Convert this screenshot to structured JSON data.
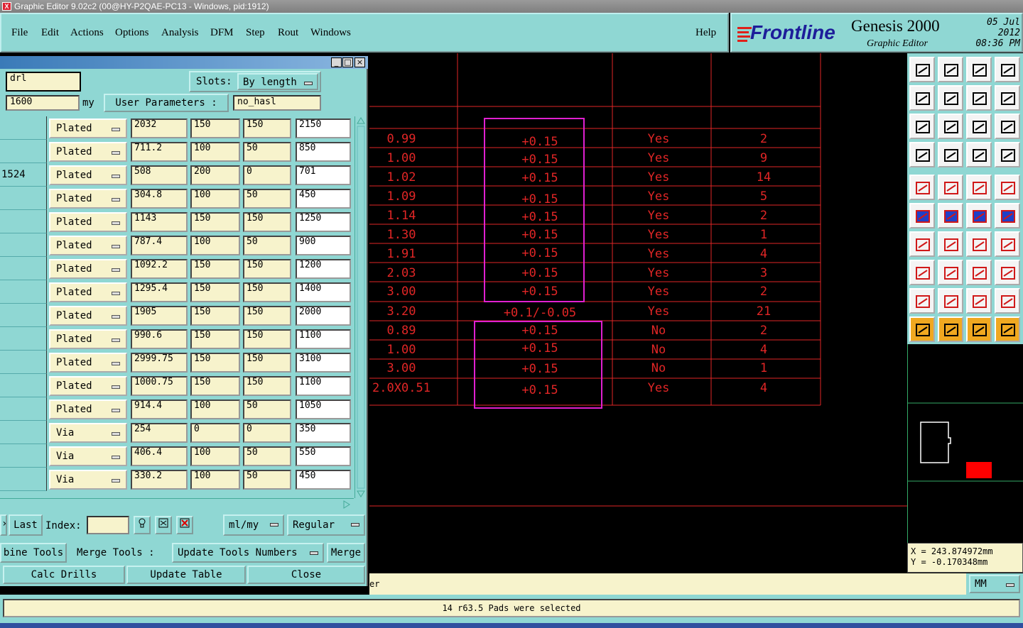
{
  "window": {
    "title": "Graphic Editor 9.02c2 (00@HY-P2QAE-PC13 - Windows, pid:1912)"
  },
  "menu": [
    "File",
    "Edit",
    "Actions",
    "Options",
    "Analysis",
    "DFM",
    "Step",
    "Rout",
    "Windows"
  ],
  "help": "Help",
  "brand": {
    "logo": "Frontline",
    "product": "Genesis 2000",
    "subtitle": "Graphic Editor",
    "date": "05 Jul 2012",
    "time": "08:36 PM"
  },
  "dialog": {
    "layer": "drl",
    "slots_label": "Slots:",
    "slots_value": "By length",
    "thickness": "1600",
    "thickness_unit": "my",
    "user_params_label": "User Parameters :",
    "user_params_value": "no_hasl",
    "rows": [
      {
        "c0": "",
        "type": "Plated",
        "v1": "2032",
        "v2": "150",
        "v3": "150",
        "v4": "2150"
      },
      {
        "c0": "",
        "type": "Plated",
        "v1": "711.2",
        "v2": "100",
        "v3": "50",
        "v4": "850"
      },
      {
        "c0": "1524",
        "type": "Plated",
        "v1": "508",
        "v2": "200",
        "v3": "0",
        "v4": "701"
      },
      {
        "c0": "",
        "type": "Plated",
        "v1": "304.8",
        "v2": "100",
        "v3": "50",
        "v4": "450"
      },
      {
        "c0": "",
        "type": "Plated",
        "v1": "1143",
        "v2": "150",
        "v3": "150",
        "v4": "1250"
      },
      {
        "c0": "",
        "type": "Plated",
        "v1": "787.4",
        "v2": "100",
        "v3": "50",
        "v4": "900"
      },
      {
        "c0": "",
        "type": "Plated",
        "v1": "1092.2",
        "v2": "150",
        "v3": "150",
        "v4": "1200"
      },
      {
        "c0": "",
        "type": "Plated",
        "v1": "1295.4",
        "v2": "150",
        "v3": "150",
        "v4": "1400"
      },
      {
        "c0": "",
        "type": "Plated",
        "v1": "1905",
        "v2": "150",
        "v3": "150",
        "v4": "2000"
      },
      {
        "c0": "",
        "type": "Plated",
        "v1": "990.6",
        "v2": "150",
        "v3": "150",
        "v4": "1100"
      },
      {
        "c0": "",
        "type": "Plated",
        "v1": "2999.75",
        "v2": "150",
        "v3": "150",
        "v4": "3100"
      },
      {
        "c0": "",
        "type": "Plated",
        "v1": "1000.75",
        "v2": "150",
        "v3": "150",
        "v4": "1100"
      },
      {
        "c0": "",
        "type": "Plated",
        "v1": "914.4",
        "v2": "100",
        "v3": "50",
        "v4": "1050"
      },
      {
        "c0": "",
        "type": "Via",
        "v1": "254",
        "v2": "0",
        "v3": "0",
        "v4": "350"
      },
      {
        "c0": "",
        "type": "Via",
        "v1": "406.4",
        "v2": "100",
        "v3": "50",
        "v4": "550"
      },
      {
        "c0": "",
        "type": "Via",
        "v1": "330.2",
        "v2": "100",
        "v3": "50",
        "v4": "450"
      }
    ],
    "last_label": "Last",
    "index_label": "Index:",
    "units_value": "ml/my",
    "mode_value": "Regular",
    "combine_tools": "bine Tools",
    "merge_tools": "Merge Tools :",
    "update_tools_numbers": "Update Tools Numbers",
    "merge": "Merge",
    "calc_drills": "Calc Drills",
    "update_table": "Update Table",
    "close": "Close"
  },
  "drawing": {
    "rows": [
      {
        "size": "0.99",
        "tol": "+0.15",
        "plated": "Yes",
        "count": "2"
      },
      {
        "size": "1.00",
        "tol": "+0.15",
        "plated": "Yes",
        "count": "9"
      },
      {
        "size": "1.02",
        "tol": "+0.15",
        "plated": "Yes",
        "count": "14"
      },
      {
        "size": "1.09",
        "tol": "+0.15",
        "plated": "Yes",
        "count": "5"
      },
      {
        "size": "1.14",
        "tol": "+0.15",
        "plated": "Yes",
        "count": "2"
      },
      {
        "size": "1.30",
        "tol": "+0.15",
        "plated": "Yes",
        "count": "1"
      },
      {
        "size": "1.91",
        "tol": "+0.15",
        "plated": "Yes",
        "count": "4"
      },
      {
        "size": "2.03",
        "tol": "+0.15",
        "plated": "Yes",
        "count": "3"
      },
      {
        "size": "3.00",
        "tol": "+0.15",
        "plated": "Yes",
        "count": "2"
      },
      {
        "size": "3.20",
        "tol": "+0.1/-0.05",
        "plated": "Yes",
        "count": "21"
      },
      {
        "size": "0.89",
        "tol": "+0.15",
        "plated": "No",
        "count": "2"
      },
      {
        "size": "1.00",
        "tol": "+0.15",
        "plated": "No",
        "count": "4"
      },
      {
        "size": "3.00",
        "tol": "+0.15",
        "plated": "No",
        "count": "1"
      },
      {
        "size": "2.0X0.51",
        "tol": "+0.15",
        "plated": "Yes",
        "count": "4"
      }
    ],
    "line_color": "#e12626",
    "highlight_color": "#e020d0"
  },
  "coords": {
    "x": "X = 243.874972mm",
    "y": "Y = -0.170348mm"
  },
  "status": {
    "partial": "er",
    "unit": "MM",
    "message": "14 r63.5 Pads were selected"
  }
}
